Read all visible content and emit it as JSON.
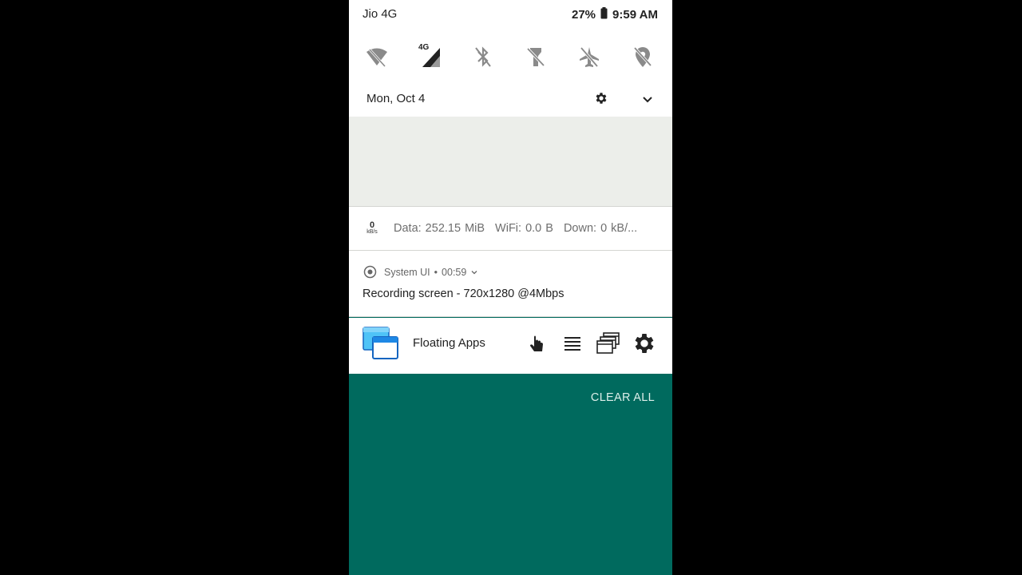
{
  "status_bar": {
    "carrier": "Jio 4G",
    "battery": "27%",
    "time": "9:59 AM"
  },
  "quick_settings": {
    "tiles": [
      {
        "icon": "wifi-off-icon"
      },
      {
        "icon": "mobile-data-icon",
        "badge": "4G"
      },
      {
        "icon": "bluetooth-off-icon"
      },
      {
        "icon": "flashlight-off-icon"
      },
      {
        "icon": "airplane-mode-off-icon"
      },
      {
        "icon": "location-off-icon"
      }
    ]
  },
  "date_row": {
    "date": "Mon, Oct 4"
  },
  "network_monitor": {
    "speed_value": "0",
    "speed_unit": "kB/s",
    "data": "Data: 252.15 MiB",
    "wifi": "WiFi: 0.0 B",
    "down": "Down: 0 kB/..."
  },
  "system_ui_notification": {
    "app_name": "System UI",
    "separator": "•",
    "elapsed": "00:59",
    "message": "Recording screen - 720x1280 @4Mbps"
  },
  "floating_apps_notification": {
    "app_name": "Floating Apps"
  },
  "actions": {
    "clear_all": "CLEAR ALL"
  },
  "colors": {
    "teal": "#006a5e",
    "panel": "#ffffff",
    "gray_area": "#eceeea",
    "fa_blue": "#1e88e5"
  }
}
